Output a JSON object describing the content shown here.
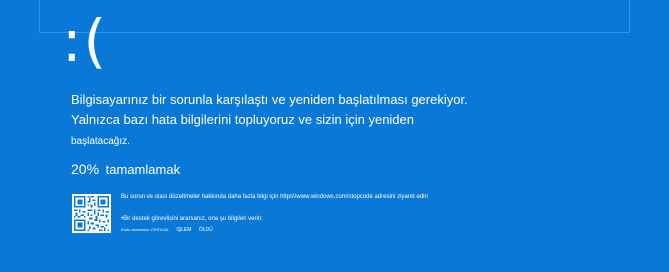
{
  "screen": {
    "background": "#0a78d7",
    "frown": ":(",
    "message_lines": [
      "Bilgisayarınız bir sorunla karşılaştı ve yeniden başlatılması gerekiyor.",
      "Yalnızca bazı hata bilgilerini topluyoruz ve sizin için yeniden"
    ],
    "restart_line": "başlatacağız.",
    "progress_percent": "20%",
    "progress_label": "tamamlamak",
    "info_text": "Bu sorun ve olası düzeltmeler hakkında daha fazla bilgi için https\\\\www.windows.com/stopcode adresini ziyaret edin",
    "support_text": "•Bir destek görevlisini ararsanız, ona şu bilgileri verin:",
    "stop_code_label": "Kodu durdurma: CRITICAL",
    "stop_code_values": [
      "IŞLEM",
      "ÖLDÜ"
    ],
    "qr_icon": "qr-code-icon"
  }
}
